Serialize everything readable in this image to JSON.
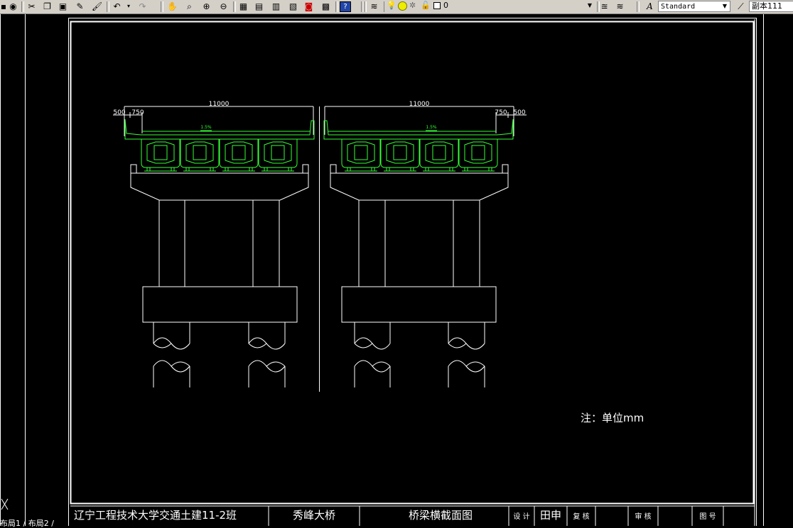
{
  "toolbar": {
    "layer_value": "0",
    "textstyle_value": "Standard",
    "dimstyle_value": "副本111",
    "icons": [
      "globe-icon",
      "cut-icon",
      "copy-icon",
      "paste-icon",
      "match-properties-icon",
      "brush-icon",
      "undo-icon",
      "redo-icon",
      "pan-icon",
      "zoom-realtime-icon",
      "zoom-window-icon",
      "zoom-previous-icon",
      "properties-icon",
      "design-center-icon",
      "tool-palettes-icon",
      "dbconnect-icon",
      "calculator-icon",
      "help-icon",
      "layer-manager-icon",
      "lightbulb-icon",
      "sun-icon",
      "freeze-icon",
      "lock-icon",
      "color-square-icon",
      "layer-previous-icon",
      "layers-icon",
      "text-style-icon",
      "dim-style-icon"
    ]
  },
  "drawing": {
    "left_section": {
      "overall_width": "11000",
      "curb_left": "500",
      "sidewalk_left": "750",
      "slope": "1.5%"
    },
    "right_section": {
      "overall_width": "11000",
      "sidewalk_right": "750",
      "curb_right": "500",
      "slope": "1.5%"
    },
    "note": "注：单位mm"
  },
  "title_block": {
    "school": "辽宁工程技术大学交通土建11-2班",
    "project": "秀峰大桥",
    "drawing_title": "桥梁横截面图",
    "designer_label": "设 计",
    "designer_name": "田申",
    "checker_label": "复 核",
    "reviewer_label": "审 核",
    "drawing_no_label": "图 号"
  },
  "status": {
    "tabs_text": "布局1 / 布局2 /"
  },
  "colors": {
    "background": "#000000",
    "lines": "#ffffff",
    "girder": "#33ff33",
    "toolbar": "#d4d0c8"
  }
}
